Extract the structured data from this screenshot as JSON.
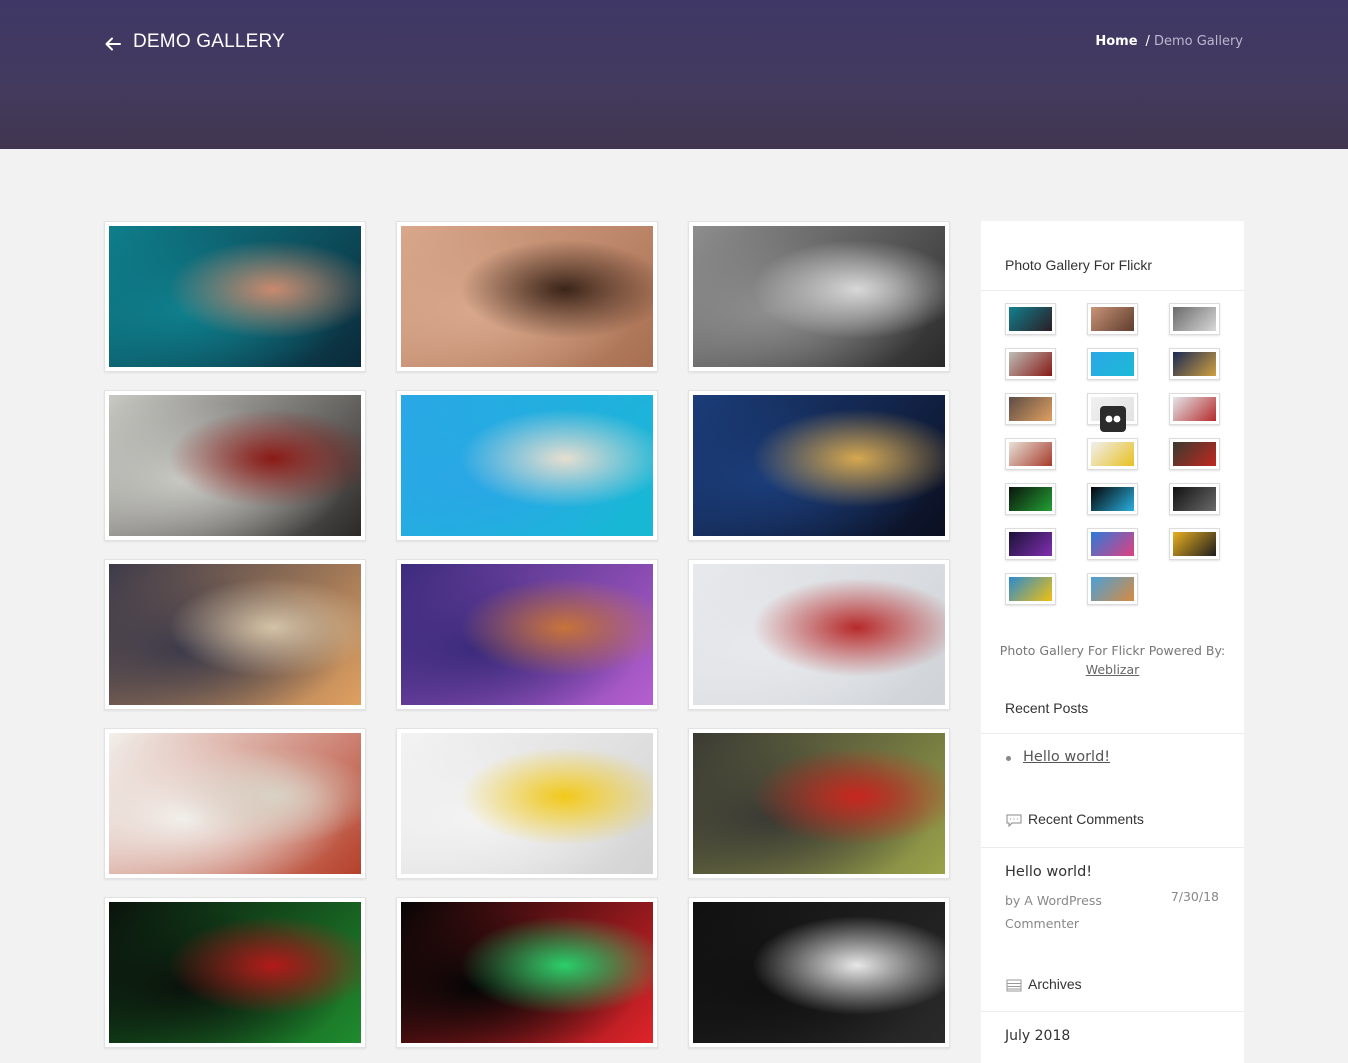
{
  "header": {
    "title": "DEMO GALLERY",
    "breadcrumb": {
      "home": "Home",
      "separator": "/",
      "current": "Demo Gallery"
    }
  },
  "gallery": {
    "items": [
      {
        "name": "woman-blue-makeup",
        "c1": "#0f7f8c",
        "c2": "#0b2a3a",
        "c3": "#c98a6e"
      },
      {
        "name": "woman-brunette",
        "c1": "#d9a88c",
        "c2": "#a86f52",
        "c3": "#3b2418"
      },
      {
        "name": "woman-black-white",
        "c1": "#8e8e8e",
        "c2": "#2a2a2a",
        "c3": "#d8d8d8"
      },
      {
        "name": "woman-with-rose",
        "c1": "#c9c9c4",
        "c2": "#2c2a28",
        "c3": "#8a1a16"
      },
      {
        "name": "resort-pool",
        "c1": "#2aa7e6",
        "c2": "#17b9d4",
        "c3": "#e6ded0"
      },
      {
        "name": "modern-house-night",
        "c1": "#1b3d7a",
        "c2": "#0b0f20",
        "c3": "#d6a850"
      },
      {
        "name": "luxury-patio",
        "c1": "#3c3a4a",
        "c2": "#e0a060",
        "c3": "#d4c2a6"
      },
      {
        "name": "fairy-castle",
        "c1": "#3b2b7c",
        "c2": "#b65fd0",
        "c3": "#c7733a"
      },
      {
        "name": "danbo-in-snow",
        "c1": "#e7e9ec",
        "c2": "#cfd3d8",
        "c3": "#b72a2a"
      },
      {
        "name": "rabbids",
        "c1": "#f2f0ec",
        "c2": "#b6402a",
        "c3": "#d9d2c5"
      },
      {
        "name": "minion",
        "c1": "#f3f3f3",
        "c2": "#d3d3d3",
        "c3": "#f2c91a"
      },
      {
        "name": "angry-fruits",
        "c1": "#3a3a34",
        "c2": "#9aa24a",
        "c3": "#c8261e"
      },
      {
        "name": "skrillex-logo",
        "c1": "#0a120c",
        "c2": "#1f8c2e",
        "c3": "#b21a1a"
      },
      {
        "name": "equalizer",
        "c1": "#050505",
        "c2": "#e0242a",
        "c3": "#2ad06a"
      },
      {
        "name": "muse-typography",
        "c1": "#101010",
        "c2": "#2a2a2a",
        "c3": "#e8e8e8"
      }
    ]
  },
  "sidebar": {
    "flickr_title": "Photo Gallery For Flickr",
    "flickr_thumbs": [
      {
        "name": "blue-makeup",
        "c1": "#12808e",
        "c2": "#2b1c24"
      },
      {
        "name": "brunette",
        "c1": "#c99478",
        "c2": "#5e3c2c"
      },
      {
        "name": "black-white",
        "c1": "#6a6a6a",
        "c2": "#d8d8d8"
      },
      {
        "name": "rose",
        "c1": "#bdbdb7",
        "c2": "#861915"
      },
      {
        "name": "pool",
        "c1": "#2aa7e6",
        "c2": "#1cbad6"
      },
      {
        "name": "house-night",
        "c1": "#1a2a55",
        "c2": "#d0a040"
      },
      {
        "name": "patio",
        "c1": "#5c4c46",
        "c2": "#e0a060"
      },
      {
        "name": "loading",
        "c1": "#f0f0f0",
        "c2": "#e2e2e2"
      },
      {
        "name": "danbo",
        "c1": "#e3e6ea",
        "c2": "#b52b2b"
      },
      {
        "name": "rabbids",
        "c1": "#e8e2d8",
        "c2": "#a53a2a"
      },
      {
        "name": "minion",
        "c1": "#f0f0f0",
        "c2": "#e8c020"
      },
      {
        "name": "fruits",
        "c1": "#3a3a30",
        "c2": "#c02820"
      },
      {
        "name": "skrillex",
        "c1": "#0a140c",
        "c2": "#24a034"
      },
      {
        "name": "equalizer",
        "c1": "#050505",
        "c2": "#2ab0e0"
      },
      {
        "name": "muse",
        "c1": "#111111",
        "c2": "#6a6a6a"
      },
      {
        "name": "concert",
        "c1": "#1c1238",
        "c2": "#8030b0"
      },
      {
        "name": "colorful",
        "c1": "#2c7ad8",
        "c2": "#e04080"
      },
      {
        "name": "panda",
        "c1": "#e8b020",
        "c2": "#1e1e1e"
      },
      {
        "name": "minions-2",
        "c1": "#2b8ad0",
        "c2": "#f0c010"
      },
      {
        "name": "family",
        "c1": "#4aa0d8",
        "c2": "#d88a40"
      }
    ],
    "powered_text": "Photo Gallery For Flickr Powered By:",
    "powered_link": "Weblizar",
    "recent_posts_title": "Recent Posts",
    "recent_posts": [
      "Hello world!"
    ],
    "recent_comments_title": "Recent Comments",
    "comment": {
      "post": "Hello world!",
      "by": "by A WordPress Commenter",
      "date": "7/30/18"
    },
    "archives_title": "Archives",
    "archives": [
      "July 2018"
    ]
  },
  "colors": {
    "header": "#433a5e",
    "background": "#f2f2f2",
    "accent": "#ffffff"
  }
}
